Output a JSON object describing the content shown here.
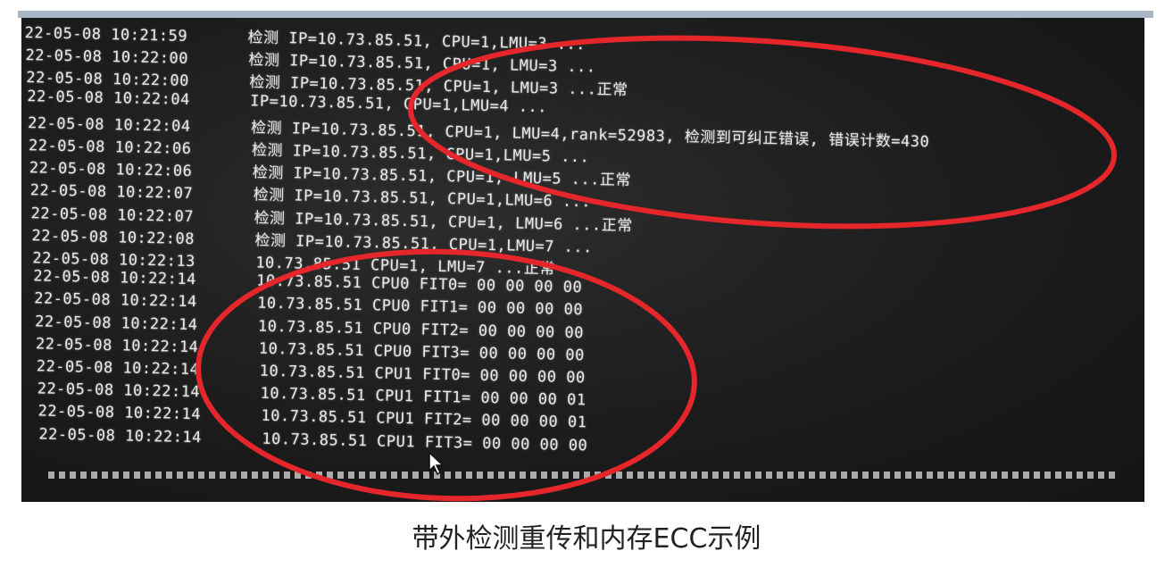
{
  "terminal_lines": [
    {
      "ts": "22-05-08 10:21:59",
      "text": "检测 IP=10.73.85.51, CPU=1,LMU=3 ..."
    },
    {
      "ts": "22-05-08 10:22:00",
      "text": "检测 IP=10.73.85.51, CPU=1, LMU=3 ..."
    },
    {
      "ts": "22-05-08 10:22:00",
      "text": "检测 IP=10.73.85.51, CPU=1, LMU=3 ...正常"
    },
    {
      "ts": "22-05-08 10:22:04",
      "text": "IP=10.73.85.51, CPU=1,LMU=4 ..."
    },
    {
      "ts": "22-05-08 10:22:04",
      "text": "检测 IP=10.73.85.51, CPU=1, LMU=4,rank=52983, 检测到可纠正错误, 错误计数=430"
    },
    {
      "ts": "22-05-08 10:22:06",
      "text": "检测 IP=10.73.85.51, CPU=1,LMU=5 ..."
    },
    {
      "ts": "22-05-08 10:22:06",
      "text": "检测 IP=10.73.85.51, CPU=1, LMU=5 ...正常"
    },
    {
      "ts": "22-05-08 10:22:07",
      "text": "检测 IP=10.73.85.51, CPU=1,LMU=6 ..."
    },
    {
      "ts": "22-05-08 10:22:07",
      "text": "检测 IP=10.73.85.51, CPU=1, LMU=6 ...正常"
    },
    {
      "ts": "22-05-08 10:22:08",
      "text": "检测 IP=10.73.85.51, CPU=1,LMU=7 ..."
    },
    {
      "ts": "22-05-08 10:22:13",
      "text": "10.73.85.51 CPU=1, LMU=7 ...正常"
    },
    {
      "ts": "22-05-08 10:22:14",
      "text": "10.73.85.51 CPU0 FIT0= 00 00 00 00"
    },
    {
      "ts": "22-05-08 10:22:14",
      "text": "10.73.85.51 CPU0 FIT1= 00 00 00 00"
    },
    {
      "ts": "22-05-08 10:22:14",
      "text": "10.73.85.51 CPU0 FIT2= 00 00 00 00"
    },
    {
      "ts": "22-05-08 10:22:14",
      "text": "10.73.85.51 CPU0 FIT3= 00 00 00 00"
    },
    {
      "ts": "22-05-08 10:22:14",
      "text": "10.73.85.51 CPU1 FIT0= 00 00 00 00"
    },
    {
      "ts": "22-05-08 10:22:14",
      "text": "10.73.85.51 CPU1 FIT1= 00 00 00 01"
    },
    {
      "ts": "22-05-08 10:22:14",
      "text": "10.73.85.51 CPU1 FIT2= 00 00 00 01"
    },
    {
      "ts": "22-05-08 10:22:14",
      "text": "10.73.85.51 CPU1 FIT3= 00 00 00 00"
    }
  ],
  "caption": "带外检测重传和内存ECC示例",
  "colors": {
    "annotation": "#e5262b",
    "terminal_bg": "#1c1c1c",
    "terminal_text": "#e8e8e8",
    "top_bar": "#a9b6c6"
  },
  "icons": {
    "cursor": "mouse-pointer-icon"
  }
}
